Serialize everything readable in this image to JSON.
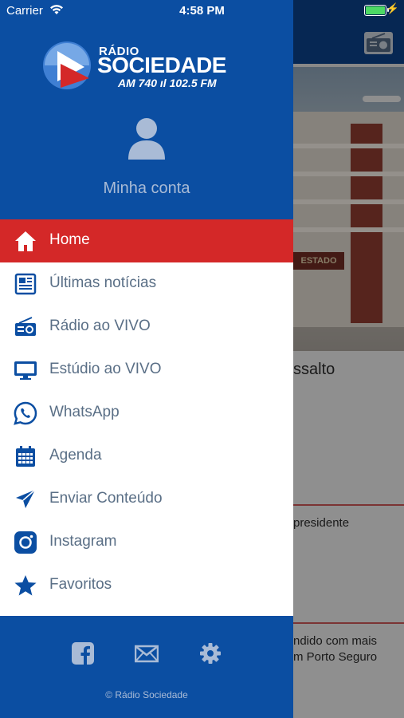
{
  "status_bar": {
    "carrier": "Carrier",
    "time": "4:58 PM"
  },
  "logo": {
    "line1": "RÁDIO",
    "line2": "SOCIEDADE",
    "line3": "AM 740 ıl 102.5 FM"
  },
  "account": {
    "label": "Minha conta"
  },
  "menu": {
    "items": [
      {
        "label": "Home",
        "icon": "home-icon"
      },
      {
        "label": "Últimas notícias",
        "icon": "newspaper-icon"
      },
      {
        "label": "Rádio ao VIVO",
        "icon": "radio-icon"
      },
      {
        "label": "Estúdio ao VIVO",
        "icon": "monitor-icon"
      },
      {
        "label": "WhatsApp",
        "icon": "whatsapp-icon"
      },
      {
        "label": "Agenda",
        "icon": "calendar-icon"
      },
      {
        "label": "Enviar Conteúdo",
        "icon": "send-icon"
      },
      {
        "label": "Instagram",
        "icon": "instagram-icon"
      },
      {
        "label": "Favoritos",
        "icon": "star-icon"
      }
    ]
  },
  "footer": {
    "copyright": "© Rádio Sociedade"
  },
  "background": {
    "sign": "ESTADO",
    "headline_fragment": "ssalto",
    "item1_fragment": "presidente",
    "item2_line1": "ndido com mais",
    "item2_line2": "m Porto Seguro"
  },
  "colors": {
    "drawer": "#0b4ea2",
    "active": "#d42828",
    "icon": "#0b4ea2",
    "label": "#5a6f86"
  }
}
